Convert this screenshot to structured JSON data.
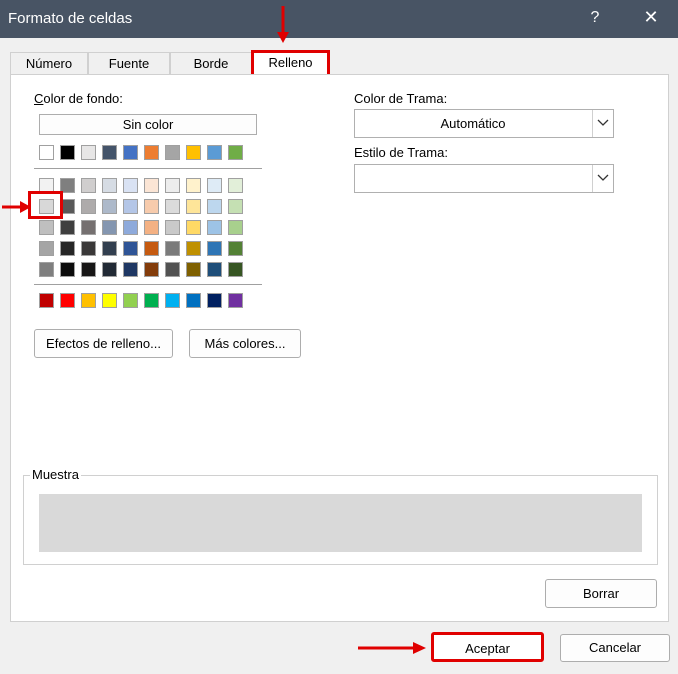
{
  "dialog": {
    "title": "Formato de celdas",
    "help": "?",
    "close": "✕"
  },
  "tabs": [
    "Número",
    "Fuente",
    "Borde",
    "Relleno"
  ],
  "fill": {
    "bg_label": "Color de fondo:",
    "no_color": "Sin color",
    "theme_row": [
      "#ffffff",
      "#000000",
      "#e7e6e6",
      "#44546a",
      "#4472c4",
      "#ed7d31",
      "#a5a5a5",
      "#ffc000",
      "#5b9bd5",
      "#70ad47"
    ],
    "shade_rows": [
      [
        "#f2f2f2",
        "#7f7f7f",
        "#d0cece",
        "#d6dce4",
        "#d9e2f3",
        "#fbe5d5",
        "#ededed",
        "#fff2cc",
        "#deebf6",
        "#e2efd9"
      ],
      [
        "#d8d8d8",
        "#595959",
        "#aeabab",
        "#adb9ca",
        "#b4c6e7",
        "#f7cbac",
        "#dbdbdb",
        "#fee599",
        "#bdd7ee",
        "#c5e0b3"
      ],
      [
        "#bfbfbf",
        "#3f3f3f",
        "#757070",
        "#8496b0",
        "#8eaadb",
        "#f4b183",
        "#c9c9c9",
        "#ffd965",
        "#9dc3e6",
        "#a8d08d"
      ],
      [
        "#a5a5a5",
        "#262626",
        "#3a3838",
        "#323f4f",
        "#2f5496",
        "#c55a11",
        "#7b7b7b",
        "#bf9000",
        "#2e75b5",
        "#538135"
      ],
      [
        "#7f7f7f",
        "#0c0c0c",
        "#171616",
        "#222a35",
        "#1f3864",
        "#833c0b",
        "#525252",
        "#7f6000",
        "#1e4e79",
        "#375623"
      ]
    ],
    "standard_row": [
      "#c00000",
      "#ff0000",
      "#ffc000",
      "#ffff00",
      "#92d050",
      "#00b050",
      "#00b0f0",
      "#0070c0",
      "#002060",
      "#7030a0"
    ],
    "selected_color": "#d8d8d8",
    "fill_effects": "Efectos de relleno...",
    "more_colors": "Más colores..."
  },
  "pattern": {
    "color_label": "Color de Trama:",
    "color_value": "Automático",
    "style_label": "Estilo de Trama:",
    "style_value": ""
  },
  "sample": {
    "label": "Muestra",
    "color": "#d9d9d9"
  },
  "buttons": {
    "clear": "Borrar",
    "ok": "Aceptar",
    "cancel": "Cancelar"
  },
  "colors": {
    "titlebar": "#485464",
    "annotation": "#e00000"
  }
}
